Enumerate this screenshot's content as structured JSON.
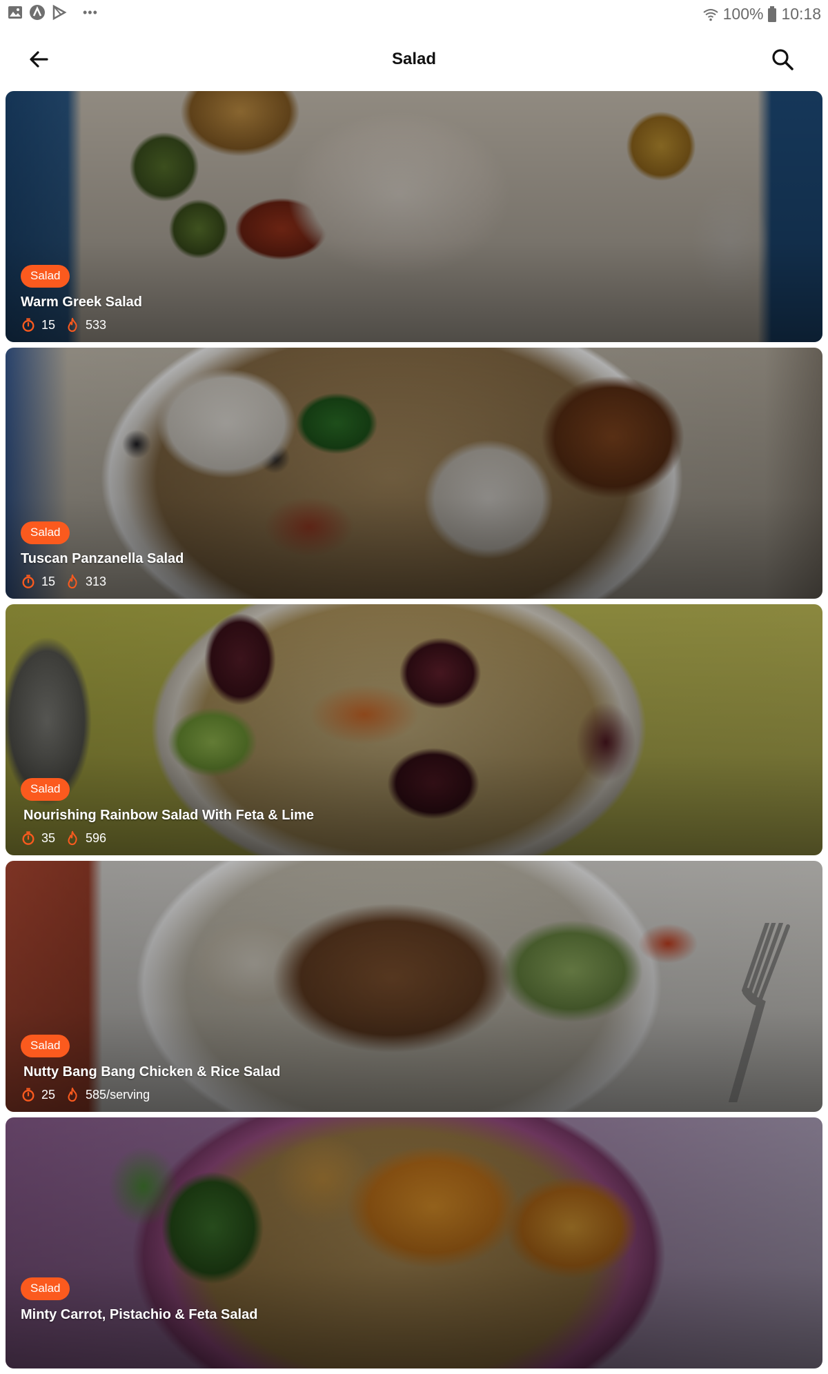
{
  "status_bar": {
    "battery": "100%",
    "time": "10:18",
    "overflow": "•••",
    "icons": [
      "image-icon",
      "arrow-badge-icon",
      "play-store-icon",
      "wifi-icon",
      "battery-icon"
    ]
  },
  "app_bar": {
    "title": "Salad",
    "back_icon": "arrow-left-icon",
    "search_icon": "search-icon"
  },
  "colors": {
    "accent": "#fb5a1e",
    "title_text": "#111111"
  },
  "recipes": [
    {
      "category": "Salad",
      "title": "Warm Greek Salad",
      "time": "15",
      "calories": "533"
    },
    {
      "category": "Salad",
      "title": "Tuscan Panzanella Salad",
      "time": "15",
      "calories": "313"
    },
    {
      "category": "Salad",
      "title": "Nourishing Rainbow Salad With Feta & Lime",
      "time": "35",
      "calories": "596"
    },
    {
      "category": "Salad",
      "title": "Nutty Bang Bang Chicken & Rice Salad",
      "time": "25",
      "calories": "585/serving"
    },
    {
      "category": "Salad",
      "title": "Minty Carrot, Pistachio & Feta Salad",
      "time": "",
      "calories": ""
    }
  ]
}
